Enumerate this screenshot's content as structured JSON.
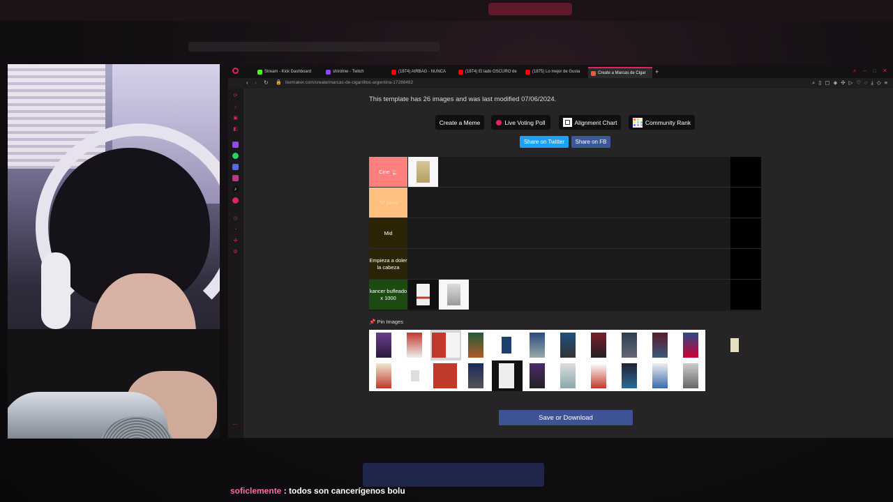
{
  "browser": {
    "tabs": [
      {
        "label": "Stream - Kick Dashboard",
        "color": "#53fc18"
      },
      {
        "label": "shirotnw - Twitch",
        "color": "#9146ff"
      },
      {
        "label": "(1874) AIRBAG - NUNCA",
        "color": "#ff0000"
      },
      {
        "label": "(1874) El lado OSCURO de",
        "color": "#ff0000"
      },
      {
        "label": "(1875) Lo mejor de Gusta",
        "color": "#ff0000"
      },
      {
        "label": "Create a Marcas de Cigar",
        "color": "#e06040"
      }
    ],
    "new_tab": "+",
    "url": "tiermaker.com/create/marcas-de-cigarrillos-argentina-17288492"
  },
  "page": {
    "info": "This template has 26 images and was last modified 07/06/2024.",
    "buttons": {
      "meme": "Create a Meme",
      "poll": "Live Voting Poll",
      "alignment": "Alignment Chart",
      "community": "Community Rank"
    },
    "share": {
      "twitter": "Share on Twitter",
      "fb": "Share on FB"
    },
    "tiers": [
      {
        "label": "Cine 🚬",
        "color": "#ff7f7f",
        "text_color": "#ffffff"
      },
      {
        "label": "Ta' piola",
        "color": "#ffbf7f",
        "text_color": "#ffd8a8"
      },
      {
        "label": "Mid",
        "color": "#2a2405",
        "text_color": "#ffffff"
      },
      {
        "label": "Empieza a doler la cabeza",
        "color": "#2a2405",
        "text_color": "#ffffff"
      },
      {
        "label": "kancer bufleado x 1000",
        "color": "#1d4a10",
        "text_color": "#ffffff"
      }
    ],
    "pin_label": "Pin Images",
    "pin_icon": "pin-icon",
    "save_label": "Save or Download"
  },
  "chat": {
    "user": "soficlemente",
    "message": " : todos son cancerígenos bolu"
  },
  "colors": {
    "accent": "#e0245e",
    "twitter": "#1da1f2",
    "fb": "#3b5998",
    "save": "#3d5396"
  }
}
